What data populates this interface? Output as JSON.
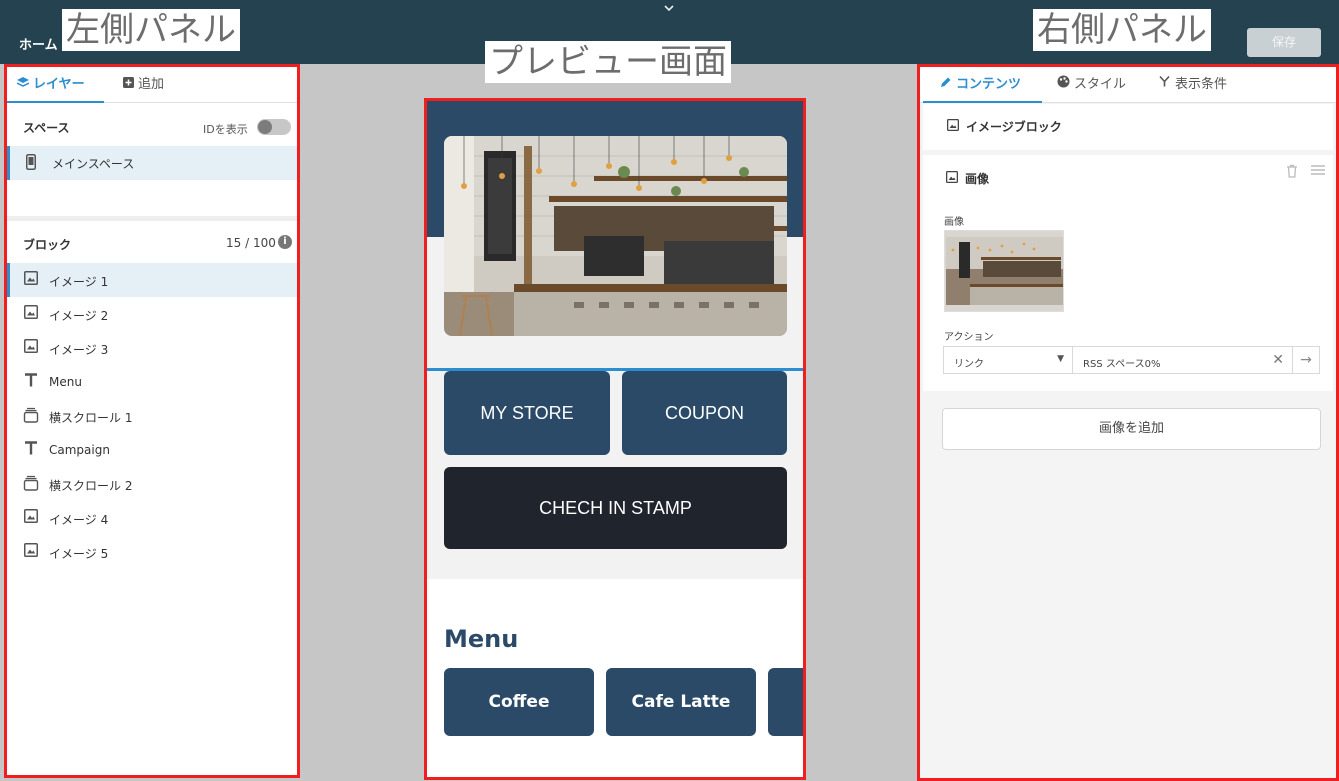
{
  "header": {
    "home_label": "ホーム",
    "chevron": "⌄",
    "save_label": "保存"
  },
  "annotations": {
    "left": "左側パネル",
    "center": "プレビュー画面",
    "right": "右側パネル"
  },
  "left_panel": {
    "tabs": [
      {
        "label": "レイヤー",
        "icon": "layers-icon",
        "active": true
      },
      {
        "label": "追加",
        "icon": "add-square-icon",
        "active": false
      }
    ],
    "space_section": {
      "title": "スペース",
      "toggle_label": "IDを表示",
      "toggle_on": false,
      "items": [
        {
          "label": "メインスペース",
          "icon": "phone-icon",
          "selected": true
        }
      ]
    },
    "block_section": {
      "title": "ブロック",
      "count": "15 / 100",
      "items": [
        {
          "label": "イメージ 1",
          "icon": "image-icon",
          "selected": true
        },
        {
          "label": "イメージ 2",
          "icon": "image-icon",
          "selected": false
        },
        {
          "label": "イメージ 3",
          "icon": "image-icon",
          "selected": false
        },
        {
          "label": "Menu",
          "icon": "text-icon",
          "selected": false
        },
        {
          "label": "横スクロール 1",
          "icon": "carousel-icon",
          "selected": false
        },
        {
          "label": "Campaign",
          "icon": "text-icon",
          "selected": false
        },
        {
          "label": "横スクロール 2",
          "icon": "carousel-icon",
          "selected": false
        },
        {
          "label": "イメージ 4",
          "icon": "image-icon",
          "selected": false
        },
        {
          "label": "イメージ 5",
          "icon": "image-icon",
          "selected": false
        }
      ]
    }
  },
  "preview": {
    "buttons": [
      "MY STORE",
      "COUPON",
      "CHECH IN STAMP"
    ],
    "menu_title": "Menu",
    "menu_items": [
      "Coffee",
      "Cafe Latte",
      ""
    ]
  },
  "right_panel": {
    "tabs": [
      {
        "label": "コンテンツ",
        "icon": "pencil-icon",
        "active": true
      },
      {
        "label": "スタイル",
        "icon": "palette-icon",
        "active": false
      },
      {
        "label": "表示条件",
        "icon": "branch-icon",
        "active": false
      }
    ],
    "block_title": "イメージブロック",
    "image_card": {
      "title": "画像",
      "image_label": "画像",
      "action_label": "アクション",
      "action_type": "リンク",
      "action_value": "RSS スペース0%"
    },
    "add_image_label": "画像を追加"
  },
  "colors": {
    "topbar": "#24424f",
    "accent": "#2a8ed0",
    "brand_navy": "#2b4a67",
    "dark_button": "#20252d",
    "highlight_border": "#ef1f1f"
  }
}
